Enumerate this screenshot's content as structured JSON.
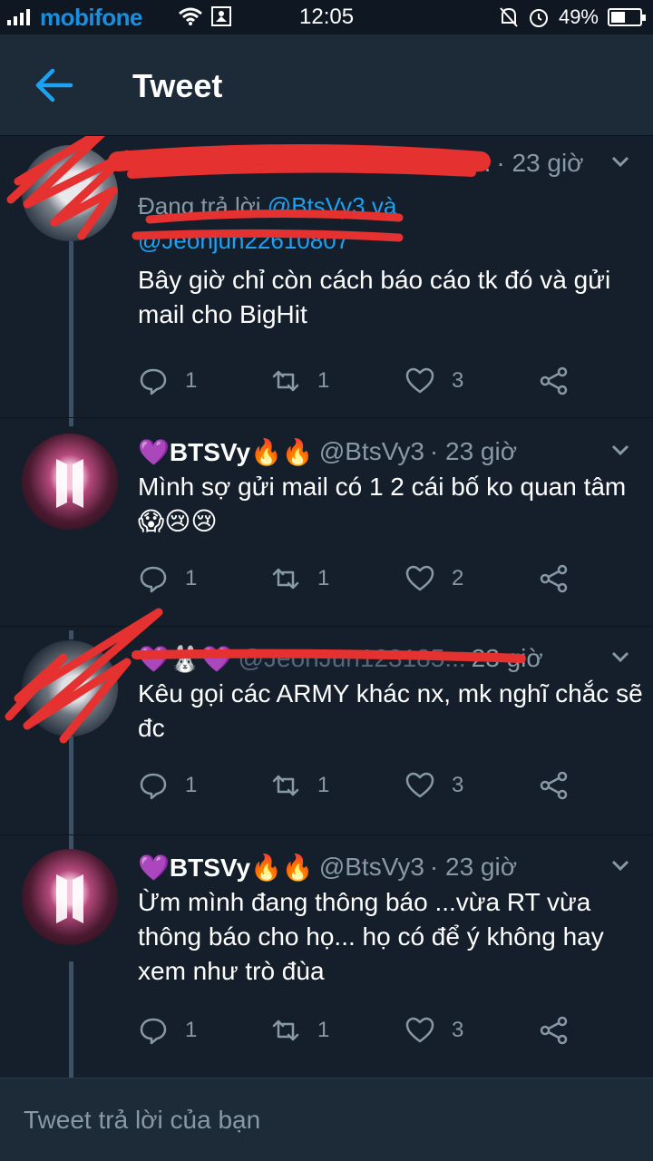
{
  "status_bar": {
    "carrier": "mobifone",
    "time": "12:05",
    "battery": "49%",
    "battery_level": 0.49,
    "icons": [
      "signal-icon",
      "wifi-icon",
      "notification-icon",
      "mute-icon",
      "alarm-icon",
      "battery-icon"
    ]
  },
  "header": {
    "title": "Tweet",
    "back_icon": "back-arrow-icon"
  },
  "colors": {
    "background": "#151f2b",
    "header": "#1d2a38",
    "accent": "#1da1f2",
    "muted": "#8899a6",
    "redaction": "#e5312f"
  },
  "tweets": [
    {
      "name": "",
      "handle": "5.",
      "time": "· 23 giờ",
      "reply_to_prefix": "Đang trả lời",
      "reply_to_mentions": "@BtsVy3 và",
      "reply_to_line2": "@Jeonjun22610807",
      "text": "Bây giờ chỉ còn cách báo cáo tk đó và gửi mail cho BigHit",
      "replies": "1",
      "retweets": "1",
      "likes": "3"
    },
    {
      "name": "💜BTSVy🔥🔥",
      "handle": "@BtsVy3",
      "time": "· 23 giờ",
      "text": "Mình sợ gửi mail có 1 2 cái bố ko quan tâm 😱😢😢",
      "replies": "1",
      "retweets": "1",
      "likes": "2"
    },
    {
      "name": "💜🐰💜",
      "handle": "@JeonJun123185...",
      "time": "23 giờ",
      "text": "Kêu gọi các ARMY khác nx, mk nghĩ chắc sẽ đc",
      "replies": "1",
      "retweets": "1",
      "likes": "3"
    },
    {
      "name": "💜BTSVy🔥🔥",
      "handle": "@BtsVy3",
      "time": "· 23 giờ",
      "text": "Ừm mình đang thông báo ...vừa RT vừa thông báo cho họ... họ có để ý không hay xem như trò đùa",
      "replies": "1",
      "retweets": "1",
      "likes": "3"
    }
  ],
  "composer": {
    "placeholder": "Tweet trả lời của bạn"
  }
}
